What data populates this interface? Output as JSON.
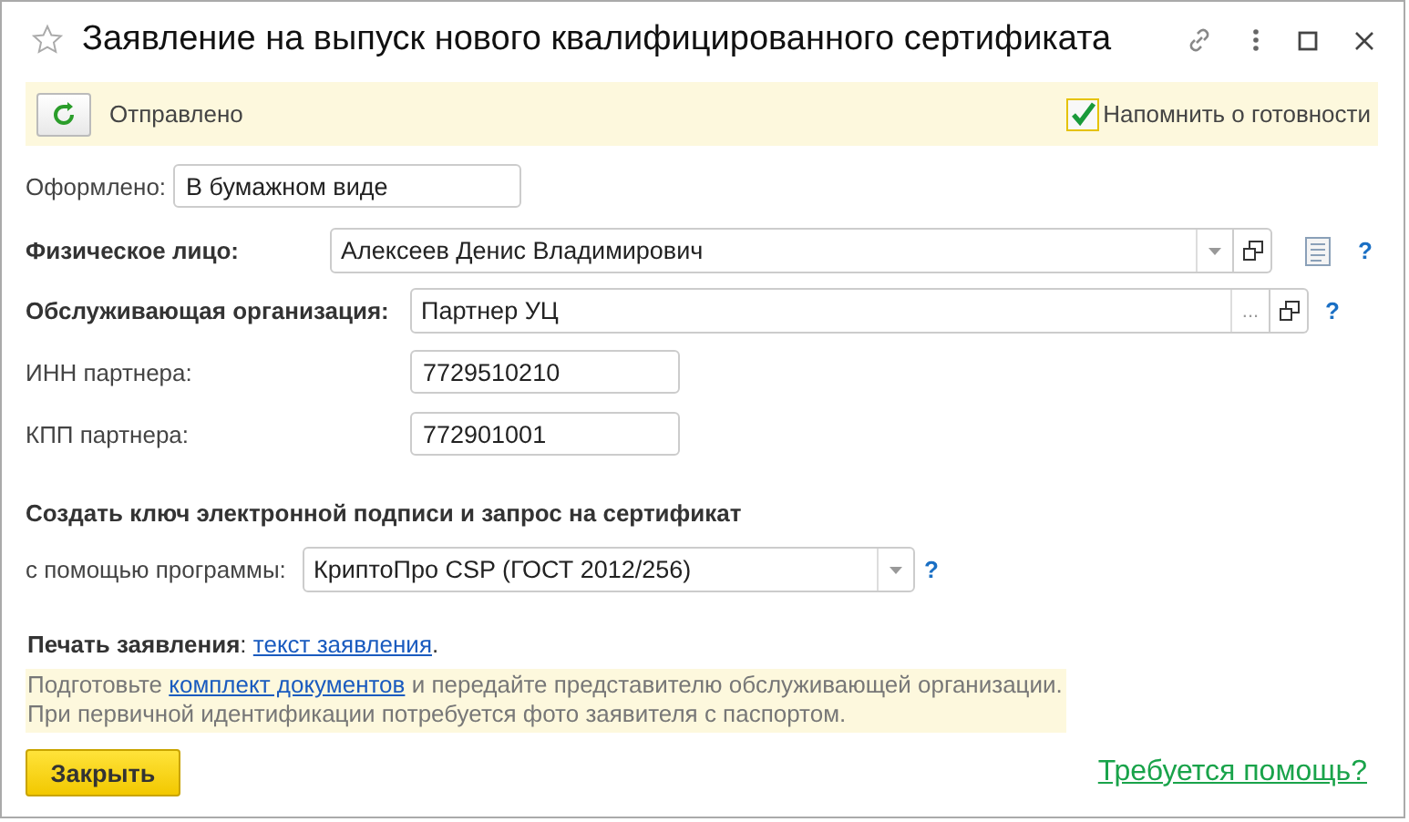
{
  "window": {
    "title": "Заявление на выпуск нового квалифицированного сертификата",
    "favorite": false
  },
  "status_bar": {
    "status": "Отправлено",
    "remind": {
      "label": "Напомнить о готовности",
      "checked": true
    }
  },
  "issued": {
    "label": "Оформлено:",
    "value": "В бумажном виде"
  },
  "person": {
    "label": "Физическое лицо:",
    "value": "Алексеев Денис Владимирович",
    "help": "?"
  },
  "organization": {
    "label": "Обслуживающая организация:",
    "value": "Партнер УЦ",
    "select": "...",
    "help": "?"
  },
  "inn": {
    "label": "ИНН партнера:",
    "value": "7729510210"
  },
  "kpp": {
    "label": "КПП партнера:",
    "value": "772901001"
  },
  "key_section": {
    "title": "Создать ключ электронной подписи и запрос на сертификат",
    "label": "с помощью программы:",
    "value": "КриптоПро CSP (ГОСТ 2012/256)",
    "help": "?"
  },
  "print": {
    "before": "**Печать заявления**: ",
    "link": "текст заявления",
    "after": "."
  },
  "note": {
    "before": "Подготовьте ",
    "link": "комплект документов",
    "after": " и передайте представителю обслуживающей организации.",
    "second_line": "При первичной идентификации потребуется фото заявителя с паспортом."
  },
  "buttons": {
    "close": "Закрыть",
    "help_link": "Требуется помощь?"
  }
}
